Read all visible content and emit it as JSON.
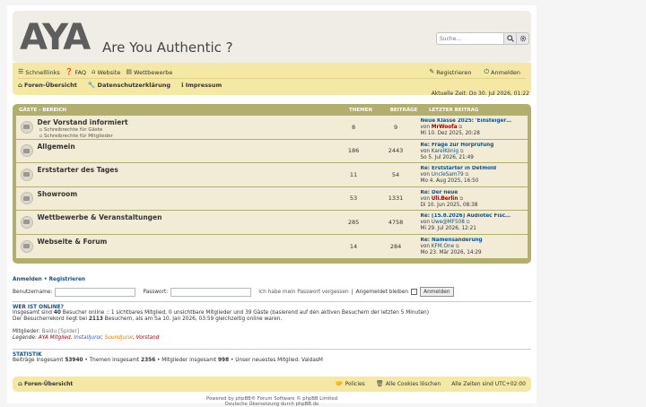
{
  "logo": {
    "mark": "AYA",
    "tagline": "Are You Authentic ?"
  },
  "search": {
    "placeholder": "Suche…",
    "search_icon": "search-icon",
    "advanced_icon": "gear-icon"
  },
  "nav": {
    "quicklinks": "Schnelllinks",
    "faq": "FAQ",
    "website": "Website",
    "contests": "Wettbewerbe",
    "register": "Registrieren",
    "login": "Anmelden",
    "forum_index": "Foren-Übersicht",
    "privacy": "Datenschutzerklärung",
    "imprint": "Impressum"
  },
  "current_time": "Aktuelle Zeit: Do 30. Jul 2026, 01:22",
  "forum_header": {
    "category": "Gäste - Bereich",
    "topics": "Themen",
    "posts": "Beiträge",
    "last_post": "Letzter Beitrag"
  },
  "forums": [
    {
      "title": "Der Vorstand informiert",
      "subs": [
        "Schreibrechte für Gäste",
        "Schreibrechte für Mitglieder"
      ],
      "topics": "8",
      "posts": "9",
      "last_title": "Neue Klasse 2025: 'Einsteiger…",
      "last_by": "von",
      "last_user": "MrWoofa",
      "last_user_red": true,
      "last_date": "Mi 10. Dez 2025, 20:28"
    },
    {
      "title": "Allgemein",
      "subs": [],
      "topics": "186",
      "posts": "2443",
      "last_title": "Re: Frage zur Hörprüfung",
      "last_by": "von",
      "last_user": "KarelKönig",
      "last_user_red": false,
      "last_date": "So 5. Jul 2026, 21:49"
    },
    {
      "title": "Erststarter des Tages",
      "subs": [],
      "topics": "11",
      "posts": "54",
      "last_title": "Re: Erststarter in Detmold",
      "last_by": "von",
      "last_user": "UncleSam79",
      "last_user_red": false,
      "last_date": "Mo 4. Aug 2025, 16:50"
    },
    {
      "title": "Showroom",
      "subs": [],
      "topics": "53",
      "posts": "1331",
      "last_title": "Re: Der neue",
      "last_by": "von",
      "last_user": "Uli.Berlin",
      "last_user_red": true,
      "last_date": "Di 10. Jun 2025, 08:38"
    },
    {
      "title": "Wettbewerbe & Veranstaltungen",
      "subs": [],
      "topics": "285",
      "posts": "4758",
      "last_title": "Re: [15.8.2026] Audiotec Fisc…",
      "last_by": "von",
      "last_user": "Uwe@MF508",
      "last_user_red": false,
      "last_date": "Mi 29. Jul 2026, 12:21"
    },
    {
      "title": "Webseite & Forum",
      "subs": [],
      "topics": "14",
      "posts": "284",
      "last_title": "Re: Namensänderung",
      "last_by": "von",
      "last_user": "KFM.One",
      "last_user_red": false,
      "last_date": "Mo 23. Mär 2026, 14:29"
    }
  ],
  "login": {
    "head_login": "Anmelden",
    "head_sep": "•",
    "head_register": "Registrieren",
    "username_label": "Benutzername:",
    "password_label": "Passwort:",
    "forgot": "Ich habe mein Passwort vergessen",
    "sep": "|",
    "remember": "Angemeldet bleiben",
    "button": "Anmelden"
  },
  "online": {
    "title": "Wer ist online?",
    "line1_pre": "Insgesamt sind ",
    "line1_num": "40",
    "line1_post": " Besucher online :: 1 sichtbares Mitglied, 0 unsichtbare Mitglieder und 39 Gäste (basierend auf den aktiven Besuchern der letzten 5 Minuten)",
    "line2_pre": "Der Besucherrekord liegt bei ",
    "line2_num": "2113",
    "line2_post": " Besuchern, als am Sa 10. Jan 2026, 03:59 gleichzeitig online waren.",
    "members_label": "Mitglieder: ",
    "members": "Baidu [Spider]",
    "legend_label": "Legende: ",
    "roles": [
      "AYA Mitglied",
      "Installjuror",
      "Soundjuror",
      "Vorstand"
    ]
  },
  "stats": {
    "title": "Statistik",
    "posts_label": "Beiträge insgesamt ",
    "posts": "53940",
    "topics_label": " • Themen insgesamt ",
    "topics": "2356",
    "members_label": " • Mitglieder insgesamt ",
    "members": "998",
    "newest_label": " • Unser neuestes Mitglied: ",
    "newest": "ValdasM"
  },
  "footer": {
    "forum_index": "Foren-Übersicht",
    "policies": "Policies",
    "cookies": "Alle Cookies löschen",
    "timezone": "Alle Zeiten sind UTC+02:00"
  },
  "copyright": {
    "line1": "Powered by phpBB® Forum Software © phpBB Limited",
    "line2": "Deutsche Übersetzung durch phpBB.de"
  }
}
